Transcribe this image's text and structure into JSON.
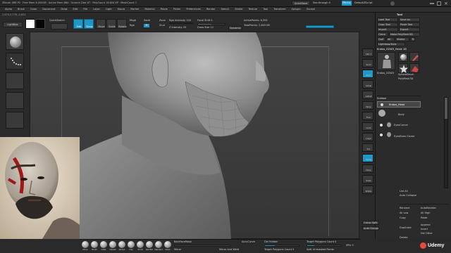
{
  "title_bar": {
    "app_title": "ZBrush 4R6 P2",
    "info": "ZBrush 4R6 P2 · Free Mem 6.000GB · Active Mem 864 · Scratch Disk 67 · PolyCount 16.604 KP · MeshCount 1",
    "quicksave": "QuickSave",
    "seethrough": "See-through 0",
    "menus": "Menus",
    "default_script": "DefaultZScript"
  },
  "menu_bar": {
    "items": [
      "Alpha",
      "Brush",
      "Color",
      "Document",
      "Draw",
      "Edit",
      "File",
      "Layer",
      "Light",
      "Macro",
      "Marker",
      "Material",
      "Movie",
      "Picker",
      "Preferences",
      "Render",
      "Stencil",
      "Stroke",
      "Texture",
      "Tool",
      "Transform",
      "Zplugin",
      "Zscript"
    ]
  },
  "status_line": "2,674,0,776,-0,624",
  "top_shelf": {
    "lightbox": "LightBox",
    "quick_sketch": "QuickSketch",
    "edit": "Edit",
    "draw": "Draw",
    "move": "Move",
    "scale": "Scale",
    "rotate": "Rotate",
    "mrgb": "Mrgb",
    "rgb": "Rgb",
    "m": "M",
    "zadd": "Zadd",
    "zsub": "Zsub",
    "zcut": "Zcut",
    "rgb_intensity": "Rgb Intensity 100",
    "z_intensity": "Z Intensity 25",
    "focal_shift": "Focal Shift 0",
    "draw_size": "Draw Size 12",
    "dynamic": "Dynamic",
    "active_points": "ActivePoints: 8,392",
    "total_points": "TotalPoints: 2,849 Mil"
  },
  "left_shelf": {
    "items": [
      "Brush",
      "Stroke",
      "Alpha",
      "Texture",
      "Material"
    ]
  },
  "right_shelf": {
    "items": [
      "SPix 3",
      "Scroll",
      "Zoom",
      "Actual",
      "AAHalf",
      "Persp",
      "Floor",
      "Local",
      "L.Sym",
      "Xyz",
      "Frame",
      "Move",
      "Scale",
      "Rotate",
      "Line Fill",
      "PolyF",
      "Transp",
      "Dynamic",
      "Solo",
      "Xpose"
    ]
  },
  "mid_panel": {
    "top_labels": [
      "ClayPolish",
      "DynaMesh",
      "MergeVisible",
      "Del Hidden",
      "Del Lower",
      "ZRemesher",
      "Auto Groups"
    ],
    "mid_labels": [
      "Smooth",
      "Sculptris Pro",
      "Divide",
      "Del Higher",
      "Reconstruct",
      "Morph Target",
      "Subdivision"
    ],
    "low_labels": [
      "Polish",
      "Crisp Edges",
      "Clay Polish",
      "Group Split",
      "Split Hidden",
      "Auto Groups"
    ]
  },
  "tool_panel": {
    "header": "Tool",
    "load_tool": "Load Tool",
    "save_as": "Save As",
    "copy_tool": "Copy Tool",
    "paste_tool": "Paste Tool",
    "import": "Import",
    "export": "Export",
    "clone": "Clone",
    "make_polymesh": "Make PolyMesh3D",
    "goz": "GoZ",
    "all": "All",
    "visible": "Visible",
    "r": "R",
    "lightbox_tools": "Lightbox▸Tools",
    "current_tool": "Kratos_GOW3_Head: 48",
    "tool_names": [
      "Kratos_GOW3",
      "SphereBrush",
      "Simple Brush",
      "PolyMesh3D",
      "Eraser",
      "Cylinder"
    ],
    "subtool": "Subtool",
    "subtool_items": [
      "Kratos_Head",
      "Body",
      "EyesCorner",
      "EyesBrow Cloner"
    ],
    "list_all": "List All",
    "auto_collapse": "Auto Collapse",
    "rename": "Rename",
    "autoreorder": "AutoReorder",
    "all_low": "All Low",
    "all_high": "All High",
    "copy": "Copy",
    "paste": "Paste",
    "duplicate": "Duplicate",
    "append": "Append",
    "insert": "Insert",
    "del_other": "Del Other",
    "delete": "Delete",
    "split": "Split"
  },
  "bottom_bar": {
    "brushes": [
      "Move",
      "Brush",
      "Inflat",
      "hPolish",
      "sPolish",
      "Clay",
      "TrimD",
      "DamStd",
      "Standard",
      "Slash"
    ],
    "backface_mask": "BackfaceMask",
    "accucurve": "AccuCurve",
    "mirror": "Mirror",
    "mirror_and_weld": "Mirror And Weld",
    "del_hidden": "Del Hidden",
    "target_polygons": "Target Polygons Count 5",
    "target_polygons2": "Target Polygons Count 5",
    "spix": "SPix 3",
    "split_unmasked": "Split Unmasked Points",
    "group_split": "Group Split",
    "auto_groups": "Auto Groups"
  },
  "watermark": {
    "brand": "Udemy"
  },
  "colors": {
    "accent": "#1f98c5",
    "panel": "#2a2a2a",
    "viewport": "#3a3a3a",
    "text": "#cfcfcf"
  }
}
